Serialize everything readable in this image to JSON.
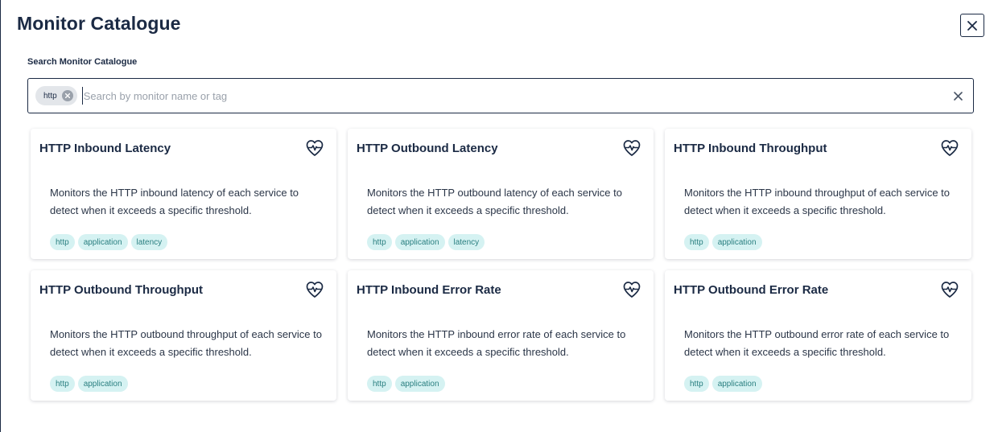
{
  "modal": {
    "title": "Monitor Catalogue"
  },
  "search": {
    "label": "Search Monitor Catalogue",
    "placeholder": "Search by monitor name or tag",
    "value": "",
    "chips": [
      {
        "label": "http"
      }
    ]
  },
  "colors": {
    "text": "#1b2a44",
    "tag_bg": "#d5f2f2",
    "tag_text": "#2a7f80",
    "chip_bg": "#e3e6ea"
  },
  "cards": [
    {
      "title": "HTTP Inbound Latency",
      "icon": "heartbeat-icon",
      "description": "Monitors the HTTP inbound latency of each service to detect when it exceeds a specific threshold.",
      "tags": [
        "http",
        "application",
        "latency"
      ]
    },
    {
      "title": "HTTP Outbound Latency",
      "icon": "heartbeat-icon",
      "description": "Monitors the HTTP outbound latency of each service to detect when it exceeds a specific threshold.",
      "tags": [
        "http",
        "application",
        "latency"
      ]
    },
    {
      "title": "HTTP Inbound Throughput",
      "icon": "heartbeat-icon",
      "description": "Monitors the HTTP inbound throughput of each service to detect when it exceeds a specific threshold.",
      "tags": [
        "http",
        "application"
      ]
    },
    {
      "title": "HTTP Outbound Throughput",
      "icon": "heartbeat-icon",
      "description": "Monitors the HTTP outbound throughput of each service to detect when it exceeds a specific threshold.",
      "tags": [
        "http",
        "application"
      ]
    },
    {
      "title": "HTTP Inbound Error Rate",
      "icon": "heartbeat-icon",
      "description": "Monitors the HTTP inbound error rate of each service to detect when it exceeds a specific threshold.",
      "tags": [
        "http",
        "application"
      ]
    },
    {
      "title": "HTTP Outbound Error Rate",
      "icon": "heartbeat-icon",
      "description": "Monitors the HTTP outbound error rate of each service to detect when it exceeds a specific threshold.",
      "tags": [
        "http",
        "application"
      ]
    }
  ]
}
